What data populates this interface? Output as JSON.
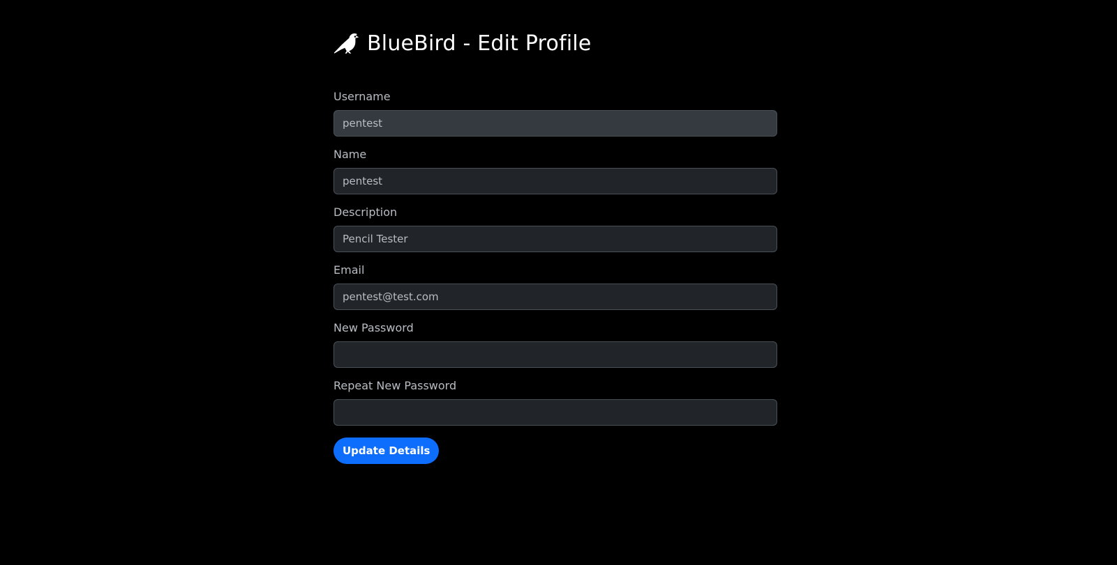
{
  "header": {
    "title": "BlueBird - Edit Profile",
    "icon": "bird-icon"
  },
  "form": {
    "fields": [
      {
        "label": "Username",
        "value": "pentest",
        "disabled": true
      },
      {
        "label": "Name",
        "value": "pentest",
        "disabled": false
      },
      {
        "label": "Description",
        "value": "Pencil Tester",
        "disabled": false
      },
      {
        "label": "Email",
        "value": "pentest@test.com",
        "disabled": false
      },
      {
        "label": "New Password",
        "value": "",
        "disabled": false
      },
      {
        "label": "Repeat New Password",
        "value": "",
        "disabled": false
      }
    ],
    "submit_label": "Update Details"
  },
  "colors": {
    "background": "#000000",
    "input_background": "#212529",
    "input_disabled_background": "#343a40",
    "accent": "#0d6efd"
  }
}
